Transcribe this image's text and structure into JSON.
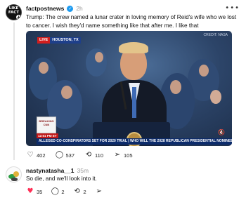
{
  "post": {
    "avatar_text": "LIKE FACT",
    "author": "factpostnews",
    "time": "2h",
    "more": "•••",
    "text": "Trump: The crew named a lunar crater in loving memory of Reid's wife who we lost to cancer. I wish they'd name something like that after me. I like that",
    "video": {
      "live_label": "LIVE",
      "location": "HOUSTON, TX",
      "credit": "CREDIT: NASA",
      "time_bug": "12:51 PM ET",
      "logo_text": "BREAKING CNN",
      "ticker": "ALLEGED CO-CONSPIRATORS SET FOR 2020 TRIAL  |  WHO WILL THE 2028 REPUBLICAN PRESIDENTIAL NOMINEE BE?"
    },
    "actions": {
      "likes": "402",
      "comments": "537",
      "reposts": "110",
      "shares": "105"
    }
  },
  "reply": {
    "author": "nastynatasha__1",
    "time": "35m",
    "text": "So die, and we'll look into it.",
    "actions": {
      "likes": "35",
      "comments": "2",
      "reposts": "2"
    }
  },
  "colors": {
    "verified": "#1d9bf0",
    "like_active": "#ff2e55",
    "live": "#d21e1e",
    "ticker": "#0c2b6b"
  },
  "icons": [
    "plus-icon",
    "verified-icon",
    "more-icon",
    "heart-icon",
    "comment-icon",
    "repost-icon",
    "share-icon",
    "mute-icon"
  ]
}
